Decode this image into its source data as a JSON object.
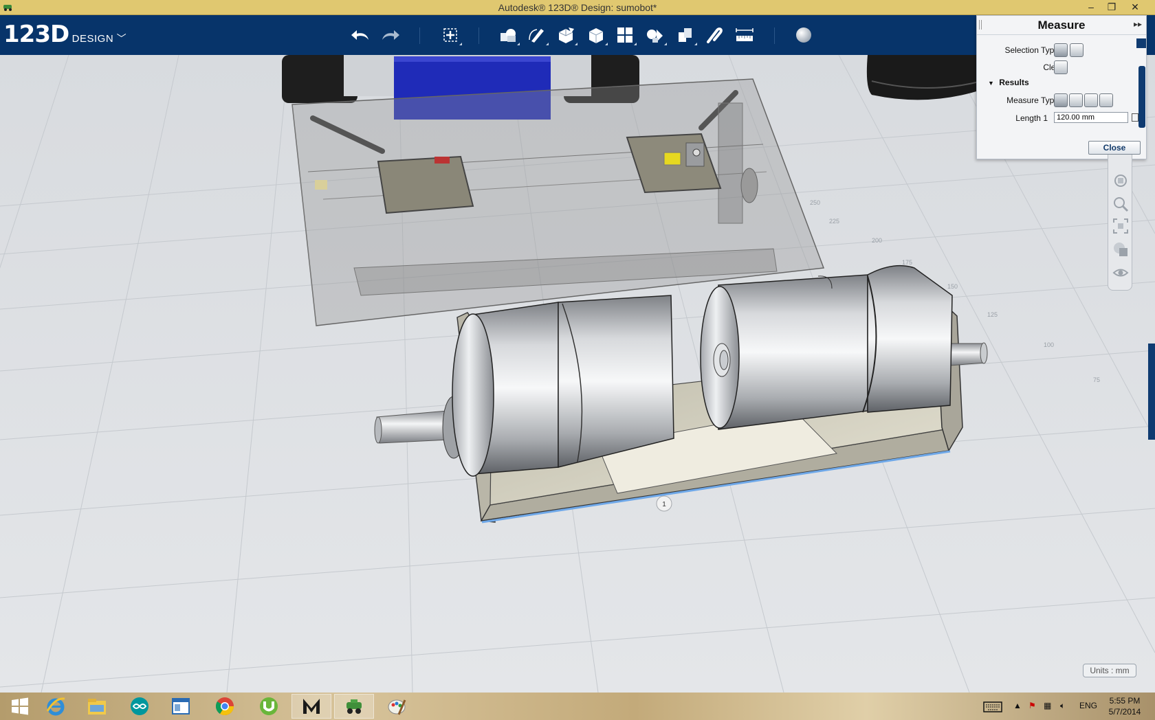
{
  "window": {
    "title": "Autodesk® 123D® Design: sumobot*",
    "buttons": [
      "–",
      "❐",
      "✕"
    ]
  },
  "toolbar": {
    "logo_big": "123D",
    "logo_small": "DESIGN",
    "tools": [
      {
        "icon": "undo-icon"
      },
      {
        "icon": "redo-icon"
      },
      {
        "icon": "transform-icon"
      },
      {
        "icon": "primitives-icon"
      },
      {
        "icon": "sketch-icon"
      },
      {
        "icon": "construct-icon"
      },
      {
        "icon": "modify-icon"
      },
      {
        "icon": "pattern-icon"
      },
      {
        "icon": "grouping-icon"
      },
      {
        "icon": "combine-icon"
      },
      {
        "icon": "snap-icon"
      },
      {
        "icon": "measure-icon"
      },
      {
        "icon": "material-icon"
      }
    ]
  },
  "measure_panel": {
    "title": "Measure",
    "selection_types_label": "Selection Types",
    "clear_label": "Clear",
    "results_label": "Results",
    "measure_types_label": "Measure Types",
    "length_label": "Length 1",
    "length_value": "120.00 mm",
    "close_label": "Close"
  },
  "viewport": {
    "dimension_marker": "1",
    "units_label": "Units : mm",
    "grid_labels": [
      "250",
      "225",
      "200",
      "175",
      "150",
      "125",
      "100",
      "75"
    ]
  },
  "taskbar": {
    "apps": [
      {
        "icon": "windows-start-icon"
      },
      {
        "icon": "internet-explorer-icon"
      },
      {
        "icon": "file-explorer-icon"
      },
      {
        "icon": "arduino-icon"
      },
      {
        "icon": "app-window-icon"
      },
      {
        "icon": "chrome-icon"
      },
      {
        "icon": "utorrent-icon"
      },
      {
        "icon": "maya-icon"
      },
      {
        "icon": "123d-design-icon"
      },
      {
        "icon": "paint-icon"
      }
    ],
    "language": "ENG",
    "time": "5:55 PM",
    "date": "5/7/2014"
  }
}
